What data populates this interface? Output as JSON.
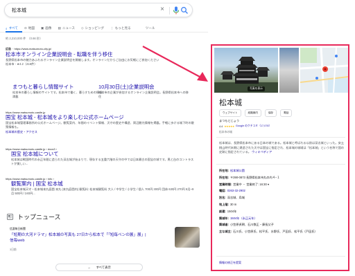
{
  "search": {
    "query": "松本城"
  },
  "tabs": [
    {
      "label": "すべて",
      "icon": "search-icon"
    },
    {
      "label": "地図",
      "icon": "map-pin-icon"
    },
    {
      "label": "画像",
      "icon": "image-icon"
    },
    {
      "label": "ニュース",
      "icon": "news-icon"
    },
    {
      "label": "ショッピング",
      "icon": "tag-icon"
    },
    {
      "label": "もっと見る",
      "icon": "more-icon"
    },
    {
      "label": "ツール",
      "icon": ""
    }
  ],
  "stats": "約 2,210,000 件　（0.66 秒）",
  "ad_result": {
    "ad_label": "広告",
    "cite": "https://www.matsumoto-city.jp/",
    "title": "松本市オンライン企業説明会 - 転職を伴う移住",
    "snippet": "長野県松本市の魅力あふれるオンライン企業説明会を開催します。オンラインだからご自由にお気軽にご参加ください",
    "location": "松本市 - ★4.2（416件）",
    "sitelinks": [
      {
        "title": "まつもと暮らし情報サイト",
        "snippet": "松本市の暮らし情報のサイトです。松本市で働く、暮らすための情報満載"
      },
      {
        "title": "10月30日(土)企業説明会",
        "snippet": "松本市の企業が参加するオンライン企業説明会。長野県松本市への移住"
      }
    ]
  },
  "result2": {
    "cite": "https://www.matsumoto-castle.jp",
    "title": "国宝 松本城 - 松本城をより楽しむ公式ホームページ",
    "snippet": "国宝松本城管理事務所の公式ホームページ。観覧案内、年間のイベント情報、天守の歴史や構造、周辺観光情報を掲載。手軽に歩ける城下町の散策情報も。",
    "link": "松本城の歴史・アクセス"
  },
  "result3": {
    "cite": "https://www.matsumoto-castle.jp › docs3 ›",
    "title": "国宝 松本城について",
    "snippet": "松本城は戦国時代の永正年間に造られた深志城が始まりで、現存する五重六階の天守の中では日本最古の国宝の城です。黒と白のコントラストが美しい..."
  },
  "result4": {
    "cite": "https://www.matsumoto-castle.jp › info ›",
    "title": "観覧案内 | 国宝 松本城",
    "snippet": "国宝松本城天守・松本城本丸庭園 本丸 (本丸庭園内) 観覧料: 松本城観覧料 大人 / 中学生 / 小学生 / 個人 700円 300円 団体 630円 270円 8月~9月 500円 / 240円..."
  },
  "news": {
    "heading": "トップニュース",
    "source": "信濃毎日新聞",
    "title": "「短期の大河ドラマ」松本城の写真も 27日から松本で「「短毎ペンの展」展」| 信毎web",
    "time": "3日前",
    "more": "すべて表示"
  },
  "kp": {
    "photo_badge": "写真を表示",
    "title": "松本城",
    "chips": [
      "ウェブサイト",
      "経路案内",
      "保存",
      "電話"
    ],
    "reading": "まつもとじょう",
    "rating": "4.4",
    "stars": "★★★★★",
    "reviews": "Google のクチコミ（17,078）",
    "category": "松本市の城",
    "description": "松本城は、長野県松本市にある日本の城である。松本城と呼ばれる以前は深志城といった。安土桃山時代末期に建造された天守は国宝に指定され、松本城の城域は「松本城」という名称で国の史跡に指定されている。",
    "wiki": "ウィキペディア",
    "facts": [
      {
        "label": "所在地:",
        "value": "松本城公園",
        "link": true
      },
      {
        "label": "所在地:",
        "value": "〒390-0873 長野県松本市丸の内４−１",
        "link": false
      },
      {
        "label": "営業時間:",
        "value": "営業中 ・ 営業終了: 16:30 ▾",
        "link": false
      },
      {
        "label": "電話:",
        "value": "0263-32-2902",
        "link": true
      },
      {
        "label": "別名:",
        "value": "深志城、烏城",
        "link": false
      },
      {
        "label": "地上階:",
        "value": "30 m",
        "link": false
      },
      {
        "label": "創建:",
        "value": "1504年",
        "link": false
      },
      {
        "label": "築城年:",
        "value": "1504年（永正元年）",
        "link": true
      },
      {
        "label": "築城者:",
        "value": "小笠原貞朝、石川数正・康長父子",
        "link": false
      },
      {
        "label": "主な城主:",
        "value": "石川氏、小笠原氏、松平氏、水野氏、戸田氏、松平氏（戸田氏）",
        "link": false
      }
    ],
    "footer": "情報の修正を提案"
  },
  "colors": {
    "accent": "#1a73e8",
    "link": "#1a0dab",
    "highlight": "#e8285a"
  }
}
